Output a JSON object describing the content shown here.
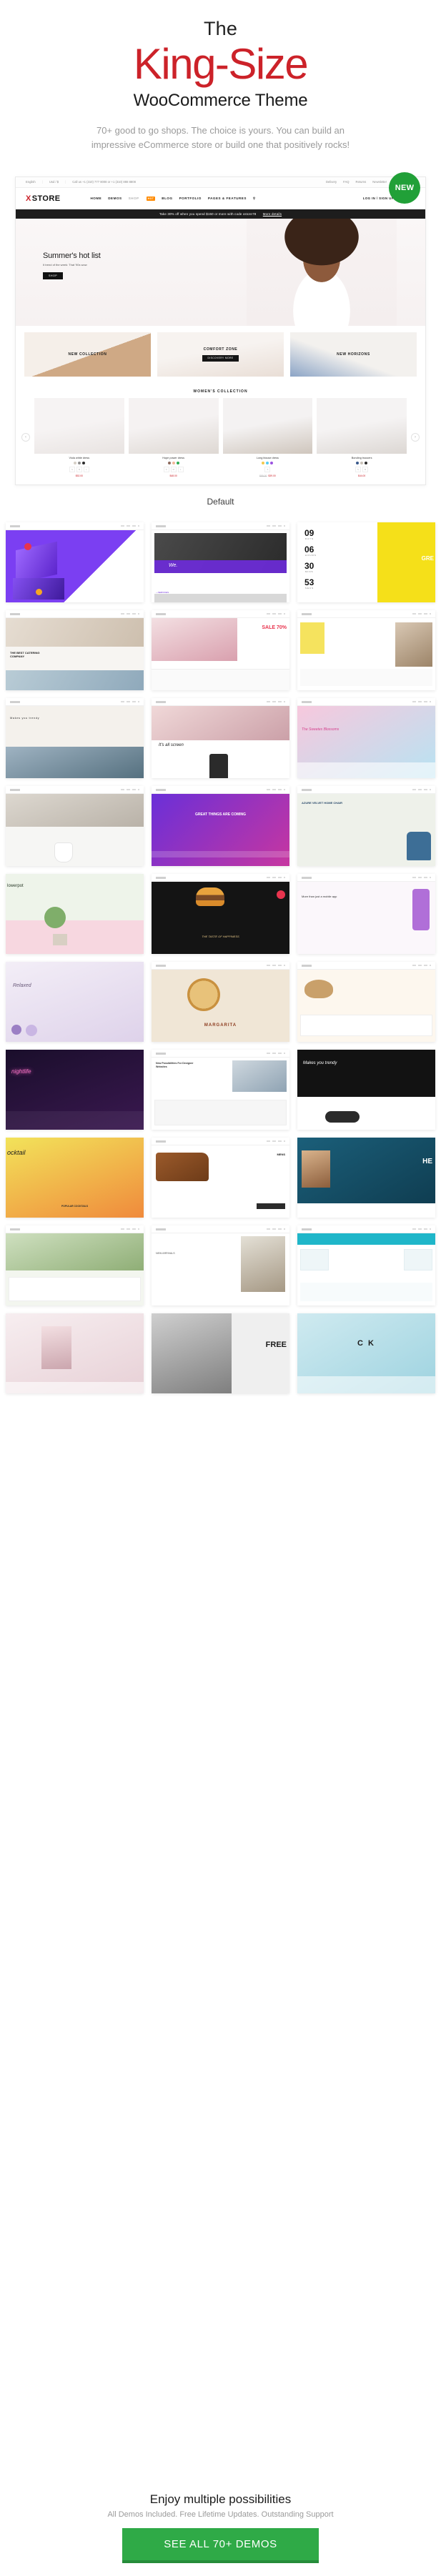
{
  "hero": {
    "eyebrow": "The",
    "title": "King-Size",
    "subtitle": "WooCommerce Theme",
    "description": "70+ good to go shops. The choice is yours. You can build an impressive eCommerce store or build one that positively rocks!"
  },
  "showcase": {
    "badge": "NEW",
    "caption": "Default",
    "topbar": {
      "language": "English",
      "currency": "Usd / $",
      "phone": "Call us +1 (310) 777 8008 or +1 (310) 888 8808",
      "links": [
        "Delivery",
        "FAQ",
        "Returns"
      ],
      "newsletter": "Newsletter"
    },
    "logo": {
      "mark": "X",
      "name": "STORE"
    },
    "nav": [
      "HOME",
      "DEMOS",
      "SHOP",
      "BLOG",
      "PORTFOLIO",
      "PAGES & FEATURES"
    ],
    "nav_hot_badge": "HOT",
    "account": "LOG IN / SIGN UP",
    "wishlist_count": "0",
    "cart_count": "0",
    "promo": "Take 30% off when you spend $150 or more with code xstore78",
    "promo_link": "More details",
    "slide": {
      "title": "Summer's hot list",
      "subtitle": "It trend of the week: That '90s wow",
      "button": "SHOP"
    },
    "categories": [
      {
        "label": "NEW COLLECTION",
        "button": ""
      },
      {
        "label": "COMFORT ZONE",
        "button": "DISCOVERY MORE"
      },
      {
        "label": "NEW HORIZONS",
        "button": ""
      }
    ],
    "section_title": "WOMEN'S COLLECTION",
    "products": [
      {
        "name": "Viola white dress",
        "colors": [
          "#d6cfc6",
          "#8f8f8f",
          "#2b2b2b"
        ],
        "sizes": [
          "S",
          "M",
          "L"
        ],
        "price": "$52.00",
        "old_price": ""
      },
      {
        "name": "Hope power dress",
        "colors": [
          "#8d6b5e",
          "#f2b79a",
          "#2fab53"
        ],
        "sizes": [
          "S",
          "M",
          "L"
        ],
        "price": "$48.00",
        "old_price": ""
      },
      {
        "name": "Long blouse dress",
        "colors": [
          "#f2c94c",
          "#56ccf2",
          "#9b51e0"
        ],
        "sizes": [
          "S"
        ],
        "price": "$39.00",
        "old_price": "$55.00"
      },
      {
        "name": "Bonding trousers",
        "colors": [
          "#3a5a8c",
          "#c9c2b8",
          "#2b2b2b"
        ],
        "sizes": [
          "S",
          "M"
        ],
        "price": "$44.00",
        "old_price": ""
      }
    ],
    "prev_arrow": "‹",
    "next_arrow": "›"
  },
  "demos": [
    {
      "name": "isometric-city-demo",
      "style": "d1"
    },
    {
      "name": "we-design-agency-demo",
      "style": "d2"
    },
    {
      "name": "countdown-coming-soon-demo",
      "style": "d3"
    },
    {
      "name": "restaurant-company-demo",
      "style": "d4"
    },
    {
      "name": "sale-fashion-demo",
      "style": "d5"
    },
    {
      "name": "bag-store-demo",
      "style": "d6"
    },
    {
      "name": "christopher-borland-demo",
      "style": "d7"
    },
    {
      "name": "its-all-screen-demo",
      "style": "d8"
    },
    {
      "name": "sweets-blossoms-demo",
      "style": "d9"
    },
    {
      "name": "bathroom-interior-demo",
      "style": "d10"
    },
    {
      "name": "great-things-demo",
      "style": "d11"
    },
    {
      "name": "azure-velvet-home-demo",
      "style": "d12"
    },
    {
      "name": "flowerpot-demo",
      "style": "d13"
    },
    {
      "name": "burger-taste-demo",
      "style": "d14"
    },
    {
      "name": "mobile-app-demo",
      "style": "d15"
    },
    {
      "name": "relaxed-lavender-demo",
      "style": "d16"
    },
    {
      "name": "margarita-pizza-demo",
      "style": "d17"
    },
    {
      "name": "glasses-shop-demo",
      "style": "d18"
    },
    {
      "name": "neon-nightlife-demo",
      "style": "d19"
    },
    {
      "name": "possibilities-demo",
      "style": "d20"
    },
    {
      "name": "makes-you-trendy-demo",
      "style": "d21"
    },
    {
      "name": "cocktail-demo",
      "style": "d22"
    },
    {
      "name": "shoes-store-demo",
      "style": "d23"
    },
    {
      "name": "barber-hair-demo",
      "style": "d24"
    },
    {
      "name": "garden-plants-demo",
      "style": "d25"
    },
    {
      "name": "hat-fashion-demo",
      "style": "d26"
    },
    {
      "name": "electronics-demo",
      "style": "d27"
    },
    {
      "name": "lingerie-demo",
      "style": "d28"
    },
    {
      "name": "free-fashion-demo",
      "style": "d29"
    },
    {
      "name": "cosmetics-demo",
      "style": "d30"
    }
  ],
  "demo_labels": {
    "countdown": {
      "days_value": "09",
      "days_label": "DAYS",
      "hours_value": "06",
      "hours_label": "HOURS",
      "mins_value": "30",
      "mins_label": "MINS",
      "secs_value": "53",
      "secs_label": "SECS",
      "headline": "GRE"
    },
    "restaurant": "THE BEST CATERING COMPANY",
    "sale": "SALE 70%",
    "its_all_screen": "It's all screen",
    "sweets": "The Sweetes Blossoms",
    "great_things": "GREAT THINGS ARE COMING",
    "azure": "AZURE VELVET HOME CHAIR",
    "flowerpot": "lowerpot",
    "burger": "THE TASTE OF HAPPINESS",
    "mobile": "More than just a mobile app",
    "relaxed": "Relaxed",
    "pizza": "MARGARITA",
    "possibilities": "New Possibilities For Designer Websites",
    "trendy": "Makes you trendy",
    "cocktail": "ocktail",
    "popular": "POPULAR COCKTAILS",
    "shoes_brand": "MENS",
    "barber": "HE",
    "free": "FREE",
    "cosmetics": "C   K"
  },
  "footer": {
    "title": "Enjoy multiple possibilities",
    "subtitle": "All Demos Included. Free Lifetime Updates. Outstanding Support",
    "cta": "SEE ALL 70+ DEMOS"
  },
  "colors": {
    "accent_red": "#cc2229",
    "cta_green": "#2faa47",
    "badge_green": "#21a038",
    "hot_orange": "#ff8a00"
  }
}
